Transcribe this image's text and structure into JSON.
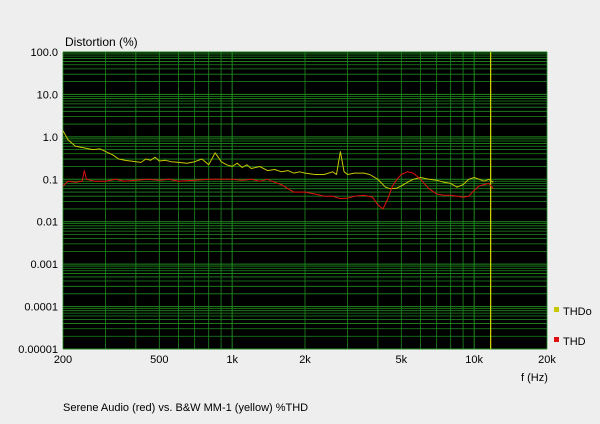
{
  "chart_data": {
    "type": "line",
    "title": "Distortion (%)",
    "xlabel": "f (Hz)",
    "ylabel": "Distortion (%)",
    "caption": "Serene Audio (red) vs. B&W MM-1 (yellow) %THD",
    "x_scale": "log",
    "y_scale": "log",
    "xlim": [
      200,
      20000
    ],
    "ylim": [
      1e-05,
      100
    ],
    "grid": true,
    "x_ticks": [
      {
        "value": 200,
        "label": "200"
      },
      {
        "value": 500,
        "label": "500"
      },
      {
        "value": 1000,
        "label": "1k"
      },
      {
        "value": 2000,
        "label": "2k"
      },
      {
        "value": 5000,
        "label": "5k"
      },
      {
        "value": 10000,
        "label": "10k"
      },
      {
        "value": 20000,
        "label": "20k"
      }
    ],
    "y_ticks": [
      {
        "value": 100,
        "label": "100.0"
      },
      {
        "value": 10,
        "label": "10.0"
      },
      {
        "value": 1,
        "label": "1.0"
      },
      {
        "value": 0.1,
        "label": "0.1"
      },
      {
        "value": 0.01,
        "label": "0.01"
      },
      {
        "value": 0.001,
        "label": "0.001"
      },
      {
        "value": 0.0001,
        "label": "0.0001"
      },
      {
        "value": 1e-05,
        "label": "0.00001"
      }
    ],
    "cursor_x": 11700,
    "legend_position": "right",
    "series": [
      {
        "name": "THDo",
        "color": "#c8c800",
        "points": [
          [
            200,
            1.4
          ],
          [
            210,
            0.85
          ],
          [
            225,
            0.6
          ],
          [
            245,
            0.55
          ],
          [
            265,
            0.5
          ],
          [
            285,
            0.52
          ],
          [
            300,
            0.45
          ],
          [
            320,
            0.38
          ],
          [
            340,
            0.3
          ],
          [
            360,
            0.28
          ],
          [
            380,
            0.27
          ],
          [
            400,
            0.26
          ],
          [
            420,
            0.25
          ],
          [
            440,
            0.3
          ],
          [
            460,
            0.28
          ],
          [
            480,
            0.33
          ],
          [
            500,
            0.27
          ],
          [
            530,
            0.28
          ],
          [
            560,
            0.26
          ],
          [
            600,
            0.25
          ],
          [
            650,
            0.24
          ],
          [
            700,
            0.26
          ],
          [
            750,
            0.3
          ],
          [
            800,
            0.22
          ],
          [
            850,
            0.42
          ],
          [
            880,
            0.32
          ],
          [
            900,
            0.26
          ],
          [
            950,
            0.22
          ],
          [
            1000,
            0.2
          ],
          [
            1050,
            0.24
          ],
          [
            1100,
            0.19
          ],
          [
            1150,
            0.22
          ],
          [
            1200,
            0.18
          ],
          [
            1300,
            0.2
          ],
          [
            1400,
            0.16
          ],
          [
            1500,
            0.17
          ],
          [
            1600,
            0.15
          ],
          [
            1700,
            0.16
          ],
          [
            1800,
            0.14
          ],
          [
            1900,
            0.15
          ],
          [
            2000,
            0.14
          ],
          [
            2200,
            0.13
          ],
          [
            2400,
            0.13
          ],
          [
            2600,
            0.15
          ],
          [
            2700,
            0.13
          ],
          [
            2800,
            0.45
          ],
          [
            2900,
            0.15
          ],
          [
            3000,
            0.13
          ],
          [
            3200,
            0.14
          ],
          [
            3500,
            0.14
          ],
          [
            3700,
            0.13
          ],
          [
            4000,
            0.1
          ],
          [
            4300,
            0.065
          ],
          [
            4500,
            0.06
          ],
          [
            4800,
            0.062
          ],
          [
            5000,
            0.07
          ],
          [
            5300,
            0.085
          ],
          [
            5600,
            0.1
          ],
          [
            6000,
            0.11
          ],
          [
            6500,
            0.1
          ],
          [
            7000,
            0.095
          ],
          [
            7500,
            0.085
          ],
          [
            8000,
            0.08
          ],
          [
            8500,
            0.065
          ],
          [
            9000,
            0.075
          ],
          [
            9500,
            0.1
          ],
          [
            10000,
            0.11
          ],
          [
            10500,
            0.1
          ],
          [
            11000,
            0.09
          ],
          [
            11500,
            0.1
          ],
          [
            12000,
            0.085
          ]
        ]
      },
      {
        "name": "THD",
        "color": "#e01010",
        "points": [
          [
            200,
            0.07
          ],
          [
            210,
            0.09
          ],
          [
            225,
            0.085
          ],
          [
            240,
            0.09
          ],
          [
            245,
            0.16
          ],
          [
            250,
            0.1
          ],
          [
            270,
            0.09
          ],
          [
            300,
            0.09
          ],
          [
            330,
            0.1
          ],
          [
            360,
            0.09
          ],
          [
            400,
            0.095
          ],
          [
            450,
            0.1
          ],
          [
            500,
            0.095
          ],
          [
            550,
            0.1
          ],
          [
            600,
            0.09
          ],
          [
            700,
            0.095
          ],
          [
            800,
            0.1
          ],
          [
            900,
            0.1
          ],
          [
            1000,
            0.1
          ],
          [
            1100,
            0.095
          ],
          [
            1200,
            0.1
          ],
          [
            1300,
            0.09
          ],
          [
            1400,
            0.1
          ],
          [
            1500,
            0.085
          ],
          [
            1600,
            0.075
          ],
          [
            1700,
            0.06
          ],
          [
            1800,
            0.05
          ],
          [
            2000,
            0.05
          ],
          [
            2200,
            0.045
          ],
          [
            2400,
            0.04
          ],
          [
            2600,
            0.04
          ],
          [
            2800,
            0.035
          ],
          [
            3000,
            0.036
          ],
          [
            3200,
            0.04
          ],
          [
            3500,
            0.042
          ],
          [
            3800,
            0.038
          ],
          [
            4000,
            0.025
          ],
          [
            4200,
            0.02
          ],
          [
            4400,
            0.035
          ],
          [
            4600,
            0.07
          ],
          [
            4800,
            0.1
          ],
          [
            5000,
            0.13
          ],
          [
            5300,
            0.15
          ],
          [
            5600,
            0.14
          ],
          [
            6000,
            0.1
          ],
          [
            6500,
            0.06
          ],
          [
            7000,
            0.045
          ],
          [
            7500,
            0.042
          ],
          [
            8000,
            0.042
          ],
          [
            8500,
            0.04
          ],
          [
            9000,
            0.038
          ],
          [
            9500,
            0.04
          ],
          [
            10000,
            0.055
          ],
          [
            10500,
            0.07
          ],
          [
            11000,
            0.075
          ],
          [
            11500,
            0.08
          ],
          [
            12000,
            0.06
          ]
        ]
      }
    ]
  }
}
